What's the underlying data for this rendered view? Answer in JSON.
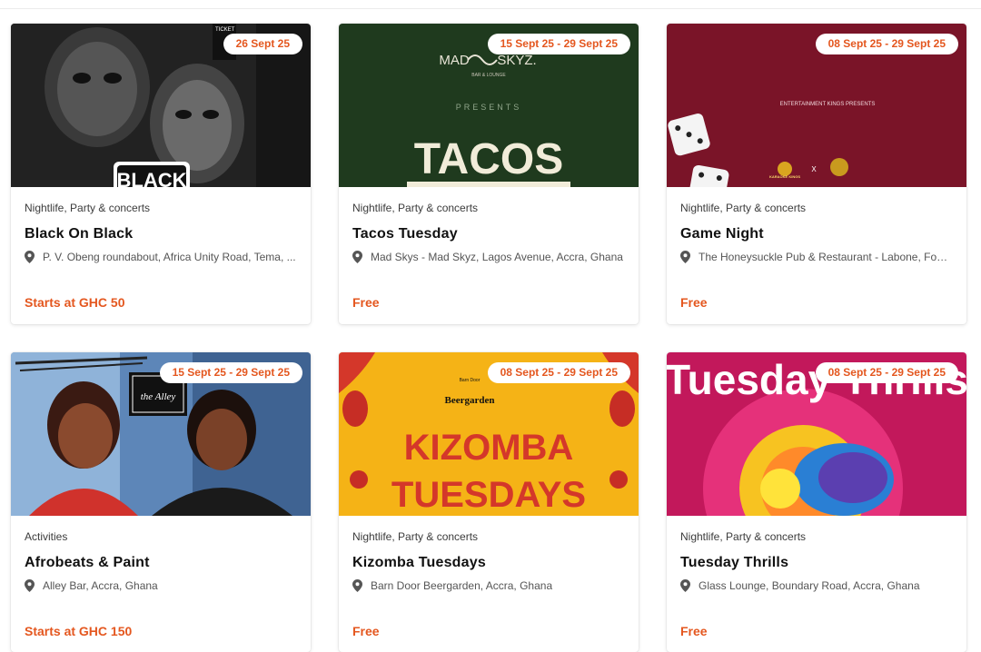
{
  "cards": [
    {
      "date": "26 Sept 25",
      "category": "Nightlife, Party & concerts",
      "title": "Black On Black",
      "location": "P. V. Obeng roundabout, Africa Unity Road, Tema, ...",
      "price": "Starts at GHC 50",
      "banner_text": "BLACK",
      "ticket_text": "TICKET"
    },
    {
      "date": "15 Sept 25 - 29 Sept 25",
      "category": "Nightlife, Party & concerts",
      "title": "Tacos Tuesday",
      "location": "Mad Skys - Mad Skyz, Lagos Avenue, Accra, Ghana",
      "price": "Free",
      "brand_left": "MAD",
      "brand_right": "SKYZ.",
      "brand_sub": "BAR & LOUNGE",
      "presents": "PRESENTS",
      "banner_text": "TACOS"
    },
    {
      "date": "08 Sept 25 - 29 Sept 25",
      "category": "Nightlife, Party & concerts",
      "title": "Game Night",
      "location": "The Honeysuckle Pub & Restaurant - Labone, Fourt...",
      "price": "Free",
      "banner_text": "ENTERTAINMENT KINGS PRESENTS",
      "sponsor": "KARAOKE KINGS",
      "times": "X"
    },
    {
      "date": "15 Sept 25 - 29 Sept 25",
      "category": "Activities",
      "title": "Afrobeats & Paint",
      "location": "Alley Bar, Accra, Ghana",
      "price": "Starts at GHC 150",
      "banner_text": "the Alley"
    },
    {
      "date": "08 Sept 25 - 29 Sept 25",
      "category": "Nightlife, Party & concerts",
      "title": "Kizomba Tuesdays",
      "location": "Barn Door Beergarden, Accra, Ghana",
      "price": "Free",
      "brand_top": "Barn Door",
      "brand": "Beergarden",
      "line1": "KIZOMBA",
      "line2": "TUESDAYS"
    },
    {
      "date": "08 Sept 25 - 29 Sept 25",
      "category": "Nightlife, Party & concerts",
      "title": "Tuesday Thrills",
      "location": "Glass Lounge, Boundary Road, Accra, Ghana",
      "price": "Free",
      "banner_text": "Tuesday Thrills"
    }
  ]
}
